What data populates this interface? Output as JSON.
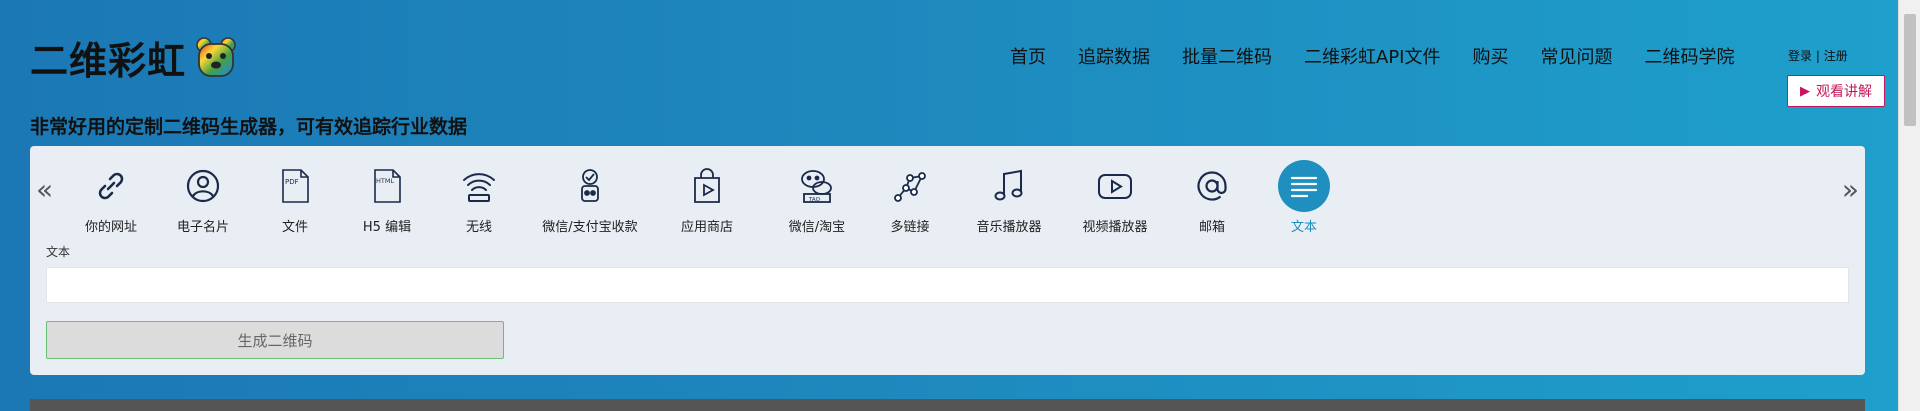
{
  "header": {
    "logo_text": "二维彩虹",
    "tagline": "非常好用的定制二维码生成器，可有效追踪行业数据",
    "nav": [
      {
        "label": "首页"
      },
      {
        "label": "追踪数据"
      },
      {
        "label": "批量二维码"
      },
      {
        "label": "二维彩虹API文件"
      },
      {
        "label": "购买"
      },
      {
        "label": "常见问题"
      },
      {
        "label": "二维码学院"
      }
    ],
    "login": "登录",
    "separator": "|",
    "register": "注册",
    "watch_label": "观看讲解"
  },
  "types": [
    {
      "label": "你的网址",
      "icon": "link-icon"
    },
    {
      "label": "电子名片",
      "icon": "user-card-icon"
    },
    {
      "label": "文件",
      "icon": "pdf-file-icon"
    },
    {
      "label": "H5 编辑",
      "icon": "html-file-icon"
    },
    {
      "label": "无线",
      "icon": "wifi-icon"
    },
    {
      "label": "微信/支付宝收款",
      "icon": "payment-icon"
    },
    {
      "label": "应用商店",
      "icon": "app-store-icon"
    },
    {
      "label": "微信/淘宝",
      "icon": "wechat-taobao-icon"
    },
    {
      "label": "多链接",
      "icon": "multi-link-icon"
    },
    {
      "label": "音乐播放器",
      "icon": "music-icon"
    },
    {
      "label": "视频播放器",
      "icon": "video-icon"
    },
    {
      "label": "邮箱",
      "icon": "email-icon"
    },
    {
      "label": "文本",
      "icon": "text-icon",
      "active": true
    }
  ],
  "form": {
    "field_label": "文本",
    "input_value": "",
    "generate_label": "生成二维码"
  },
  "colors": {
    "accent": "#1e8fbf",
    "watch_button": "#c2185b"
  }
}
